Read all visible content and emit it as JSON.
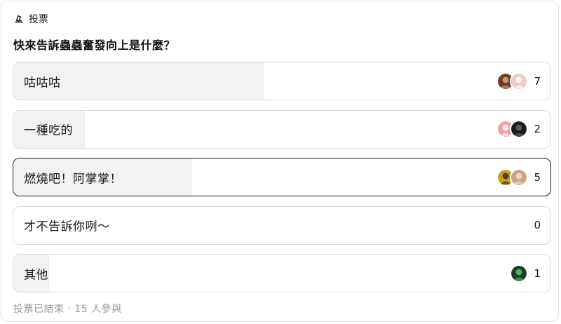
{
  "poll": {
    "header_label": "投票",
    "question": "快來告訴蟲蟲奮發向上是什麼？",
    "options": [
      {
        "label": "咕咕咕",
        "count": "7",
        "share": 0.467,
        "selected": false,
        "avatars": [
          {
            "color": "#6b3b2a",
            "accent": "#d9a58a"
          },
          {
            "color": "#f5c6c6",
            "accent": "#ffffff"
          }
        ]
      },
      {
        "label": "一種吃的",
        "count": "2",
        "share": 0.133,
        "selected": false,
        "avatars": [
          {
            "color": "#f2a0a0",
            "accent": "#ffffff"
          },
          {
            "color": "#1a1a1a",
            "accent": "#666666"
          }
        ]
      },
      {
        "label": "燃燒吧！阿掌掌！",
        "count": "5",
        "share": 0.333,
        "selected": true,
        "avatars": [
          {
            "color": "#c8a020",
            "accent": "#3a2a10"
          },
          {
            "color": "#c9a28a",
            "accent": "#f0e0d0"
          }
        ]
      },
      {
        "label": "才不告訴你咧～",
        "count": "0",
        "share": 0.0,
        "selected": false,
        "avatars": []
      },
      {
        "label": "其他",
        "count": "1",
        "share": 0.067,
        "selected": false,
        "avatars": [
          {
            "color": "#1e3a2a",
            "accent": "#5cc06a"
          }
        ]
      }
    ],
    "footer": "投票已結束 · 15 人參與"
  },
  "colors": {
    "fill": "#f2f2f2",
    "border": "#dcdcdc",
    "selected_border": "#1a1a1a",
    "muted_text": "#999999"
  },
  "icons": {
    "header": "poll-icon"
  }
}
